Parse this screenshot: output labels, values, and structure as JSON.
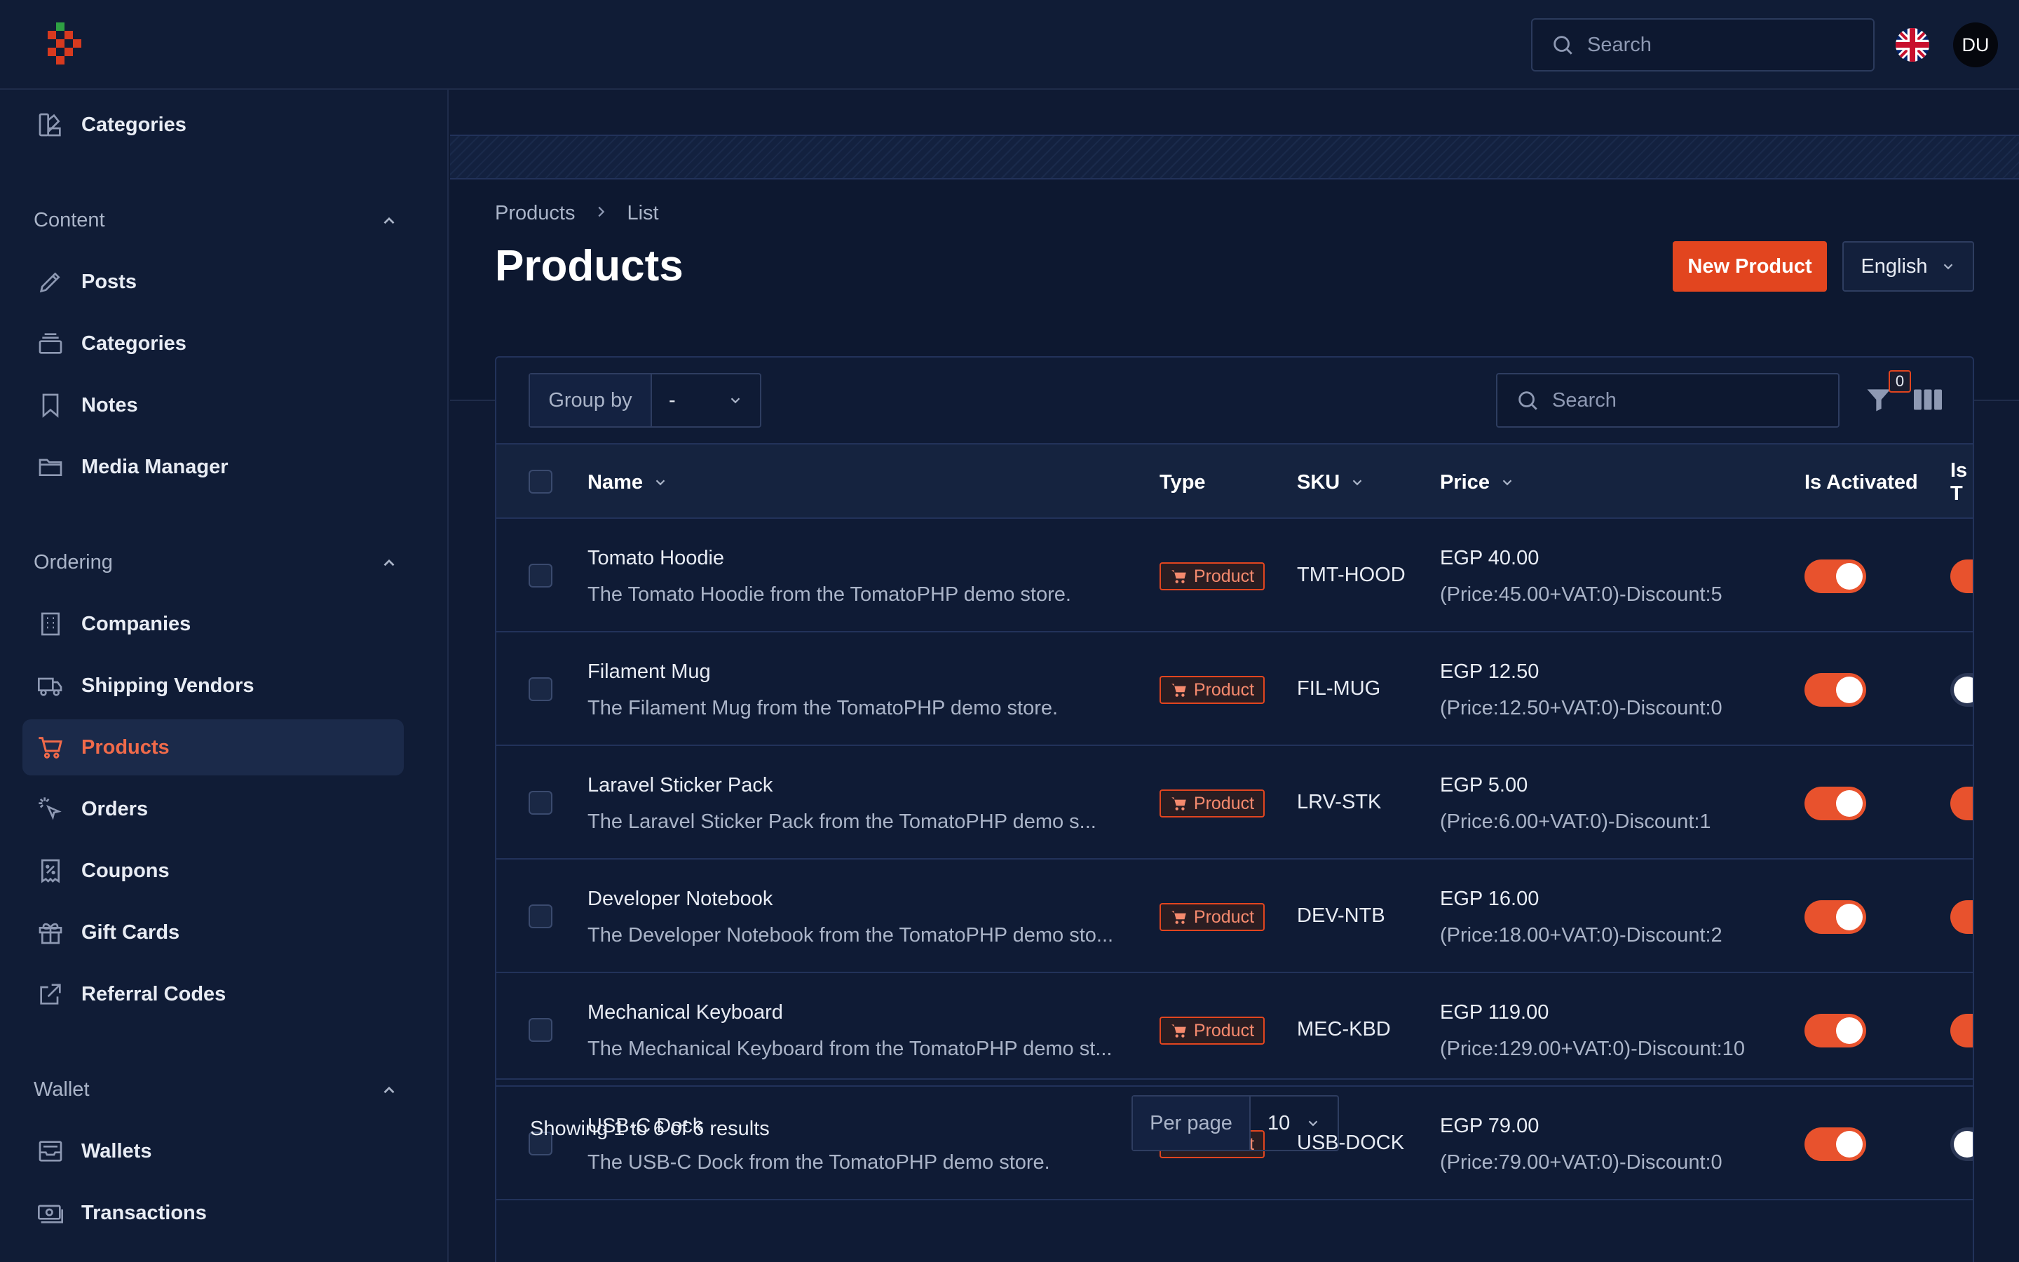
{
  "topbar": {
    "search_placeholder": "Search",
    "avatar_initials": "DU"
  },
  "sidebar": {
    "top_item": "Categories",
    "groups": {
      "content": "Content",
      "ordering": "Ordering",
      "wallet": "Wallet"
    },
    "content_items": [
      "Posts",
      "Categories",
      "Notes",
      "Media Manager"
    ],
    "ordering_items": [
      "Companies",
      "Shipping Vendors",
      "Products",
      "Orders",
      "Coupons",
      "Gift Cards",
      "Referral Codes"
    ],
    "wallet_items": [
      "Wallets",
      "Transactions"
    ]
  },
  "breadcrumb": {
    "root": "Products",
    "current": "List"
  },
  "page": {
    "title": "Products",
    "new_button": "New Product",
    "language": "English"
  },
  "table": {
    "group_by_label": "Group by",
    "group_by_value": "-",
    "search_placeholder": "Search",
    "filter_count": "0",
    "columns": {
      "name": "Name",
      "type": "Type",
      "sku": "SKU",
      "price": "Price",
      "is_activated": "Is Activated",
      "next": "Is T"
    },
    "rows": [
      {
        "name": "Tomato Hoodie",
        "desc": "The Tomato Hoodie from the TomatoPHP demo store.",
        "type": "Product",
        "sku": "TMT-HOOD",
        "price": "EGP 40.00",
        "price_detail": "(Price:45.00+VAT:0)-Discount:5",
        "activated": true,
        "next_on": true
      },
      {
        "name": "Filament Mug",
        "desc": "The Filament Mug from the TomatoPHP demo store.",
        "type": "Product",
        "sku": "FIL-MUG",
        "price": "EGP 12.50",
        "price_detail": "(Price:12.50+VAT:0)-Discount:0",
        "activated": true,
        "next_on": false
      },
      {
        "name": "Laravel Sticker Pack",
        "desc": "The Laravel Sticker Pack from the TomatoPHP demo s...",
        "type": "Product",
        "sku": "LRV-STK",
        "price": "EGP 5.00",
        "price_detail": "(Price:6.00+VAT:0)-Discount:1",
        "activated": true,
        "next_on": true
      },
      {
        "name": "Developer Notebook",
        "desc": "The Developer Notebook from the TomatoPHP demo sto...",
        "type": "Product",
        "sku": "DEV-NTB",
        "price": "EGP 16.00",
        "price_detail": "(Price:18.00+VAT:0)-Discount:2",
        "activated": true,
        "next_on": true
      },
      {
        "name": "Mechanical Keyboard",
        "desc": "The Mechanical Keyboard from the TomatoPHP demo st...",
        "type": "Product",
        "sku": "MEC-KBD",
        "price": "EGP 119.00",
        "price_detail": "(Price:129.00+VAT:0)-Discount:10",
        "activated": true,
        "next_on": true
      },
      {
        "name": "USB-C Dock",
        "desc": "The USB-C Dock from the TomatoPHP demo store.",
        "type": "Product",
        "sku": "USB-DOCK",
        "price": "EGP 79.00",
        "price_detail": "(Price:79.00+VAT:0)-Discount:0",
        "activated": true,
        "next_on": false
      }
    ],
    "showing": "Showing 1 to 6 of 6 results",
    "per_page_label": "Per page",
    "per_page_value": "10"
  },
  "colors": {
    "accent": "#e2451f",
    "background": "#0f1a33",
    "toggle_on": "#e8522d"
  }
}
